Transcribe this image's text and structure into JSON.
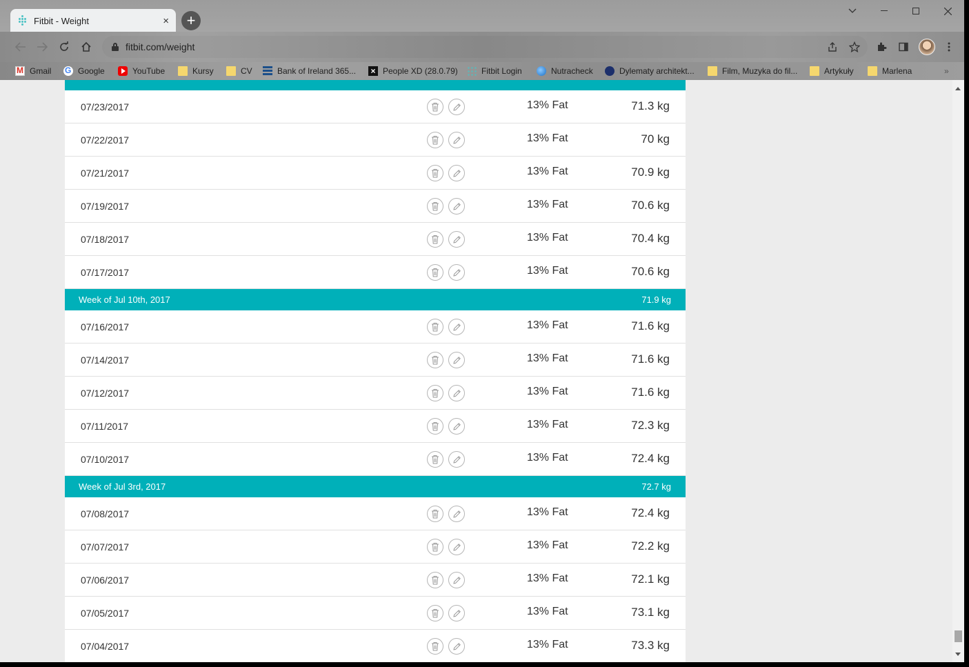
{
  "browser": {
    "tab_title": "Fitbit - Weight",
    "tab_close": "×",
    "new_tab": "+",
    "url": "fitbit.com/weight"
  },
  "bookmarks": [
    {
      "label": "Gmail",
      "icon": "gmail-icon"
    },
    {
      "label": "Google",
      "icon": "google-icon"
    },
    {
      "label": "YouTube",
      "icon": "youtube-icon"
    },
    {
      "label": "Kursy",
      "icon": "folder-icon"
    },
    {
      "label": "CV",
      "icon": "folder-icon"
    },
    {
      "label": "Bank of Ireland 365...",
      "icon": "bank-of-ireland-icon"
    },
    {
      "label": "People XD (28.0.79)",
      "icon": "people-xd-icon"
    },
    {
      "label": "Fitbit Login",
      "icon": "fitbit-icon"
    },
    {
      "label": "Nutracheck",
      "icon": "nutracheck-icon"
    },
    {
      "label": "Dylematy architekt...",
      "icon": "dylematy-icon"
    },
    {
      "label": "Film, Muzyka do fil...",
      "icon": "folder-icon"
    },
    {
      "label": "Artykuły",
      "icon": "folder-icon"
    },
    {
      "label": "Marlena",
      "icon": "folder-icon"
    }
  ],
  "bookmarks_more": "»",
  "weight_log": {
    "colors": {
      "week_header": "#00b0b9"
    },
    "groups": [
      {
        "week_label": "",
        "week_avg": "",
        "entries": [
          {
            "date": "07/23/2017",
            "fat": "13% Fat",
            "weight": "71.3 kg"
          },
          {
            "date": "07/22/2017",
            "fat": "13% Fat",
            "weight": "70 kg"
          },
          {
            "date": "07/21/2017",
            "fat": "13% Fat",
            "weight": "70.9 kg"
          },
          {
            "date": "07/19/2017",
            "fat": "13% Fat",
            "weight": "70.6 kg"
          },
          {
            "date": "07/18/2017",
            "fat": "13% Fat",
            "weight": "70.4 kg"
          },
          {
            "date": "07/17/2017",
            "fat": "13% Fat",
            "weight": "70.6 kg"
          }
        ]
      },
      {
        "week_label": "Week of Jul 10th, 2017",
        "week_avg": "71.9 kg",
        "entries": [
          {
            "date": "07/16/2017",
            "fat": "13% Fat",
            "weight": "71.6 kg"
          },
          {
            "date": "07/14/2017",
            "fat": "13% Fat",
            "weight": "71.6 kg"
          },
          {
            "date": "07/12/2017",
            "fat": "13% Fat",
            "weight": "71.6 kg"
          },
          {
            "date": "07/11/2017",
            "fat": "13% Fat",
            "weight": "72.3 kg"
          },
          {
            "date": "07/10/2017",
            "fat": "13% Fat",
            "weight": "72.4 kg"
          }
        ]
      },
      {
        "week_label": "Week of Jul 3rd, 2017",
        "week_avg": "72.7 kg",
        "entries": [
          {
            "date": "07/08/2017",
            "fat": "13% Fat",
            "weight": "72.4 kg"
          },
          {
            "date": "07/07/2017",
            "fat": "13% Fat",
            "weight": "72.2 kg"
          },
          {
            "date": "07/06/2017",
            "fat": "13% Fat",
            "weight": "72.1 kg"
          },
          {
            "date": "07/05/2017",
            "fat": "13% Fat",
            "weight": "73.1 kg"
          },
          {
            "date": "07/04/2017",
            "fat": "13% Fat",
            "weight": "73.3 kg"
          }
        ]
      }
    ]
  }
}
